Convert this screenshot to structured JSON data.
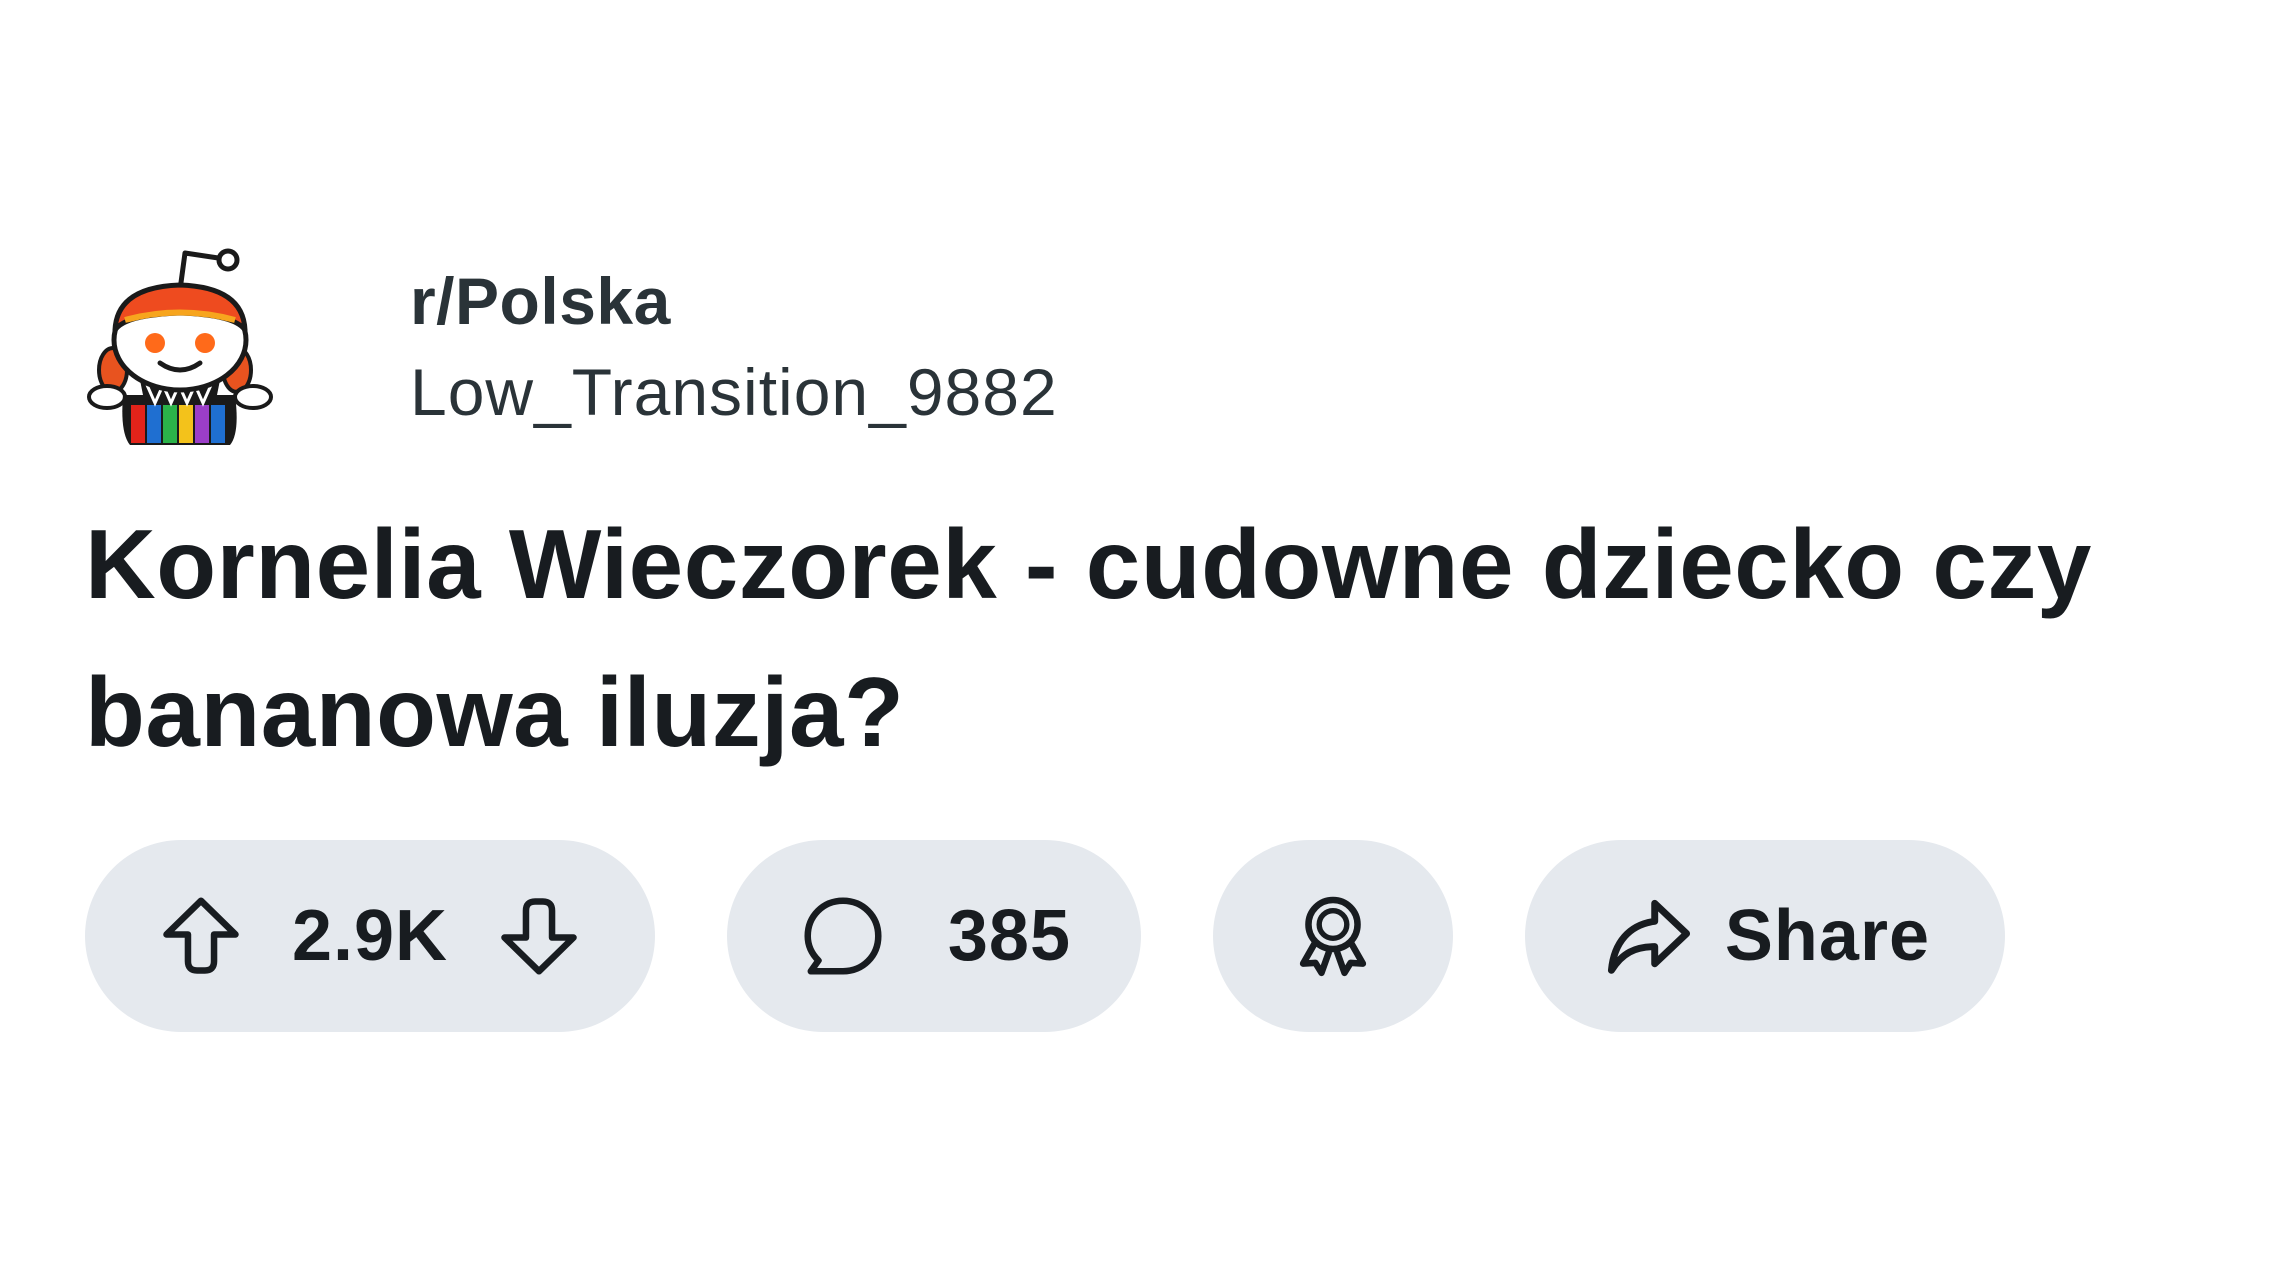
{
  "post": {
    "subreddit": "r/Polska",
    "author": "Low_Transition_9882",
    "title": "Kornelia Wieczorek - cudowne dziecko czy bananowa iluzja?"
  },
  "actions": {
    "vote_count": "2.9K",
    "comment_count": "385",
    "share_label": "Share"
  },
  "icons": {
    "avatar": "subreddit-snoo-folk-avatar",
    "upvote": "arrow-up-outline-icon",
    "downvote": "arrow-down-outline-icon",
    "comment": "speech-bubble-icon",
    "award": "award-ribbon-icon",
    "share": "share-arrow-icon"
  },
  "colors": {
    "pill_background": "#e5e9ee",
    "text_primary": "#181c20",
    "text_meta": "#2a3338",
    "avatar_hair": "#ee4b1f",
    "avatar_eyes": "#ff6a1a"
  }
}
